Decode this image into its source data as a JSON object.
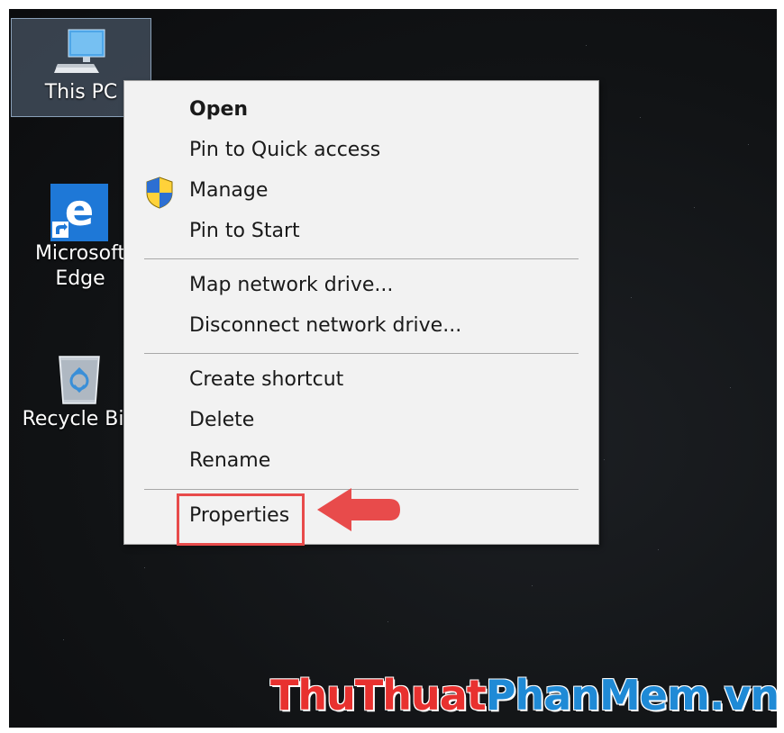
{
  "desktop": {
    "icons": [
      {
        "label": "This PC",
        "icon": "this-pc-icon"
      },
      {
        "label_line1": "Microsoft",
        "label_line2": "Edge",
        "icon": "edge-icon"
      },
      {
        "label": "Recycle Bin",
        "icon": "recycle-bin-icon"
      }
    ]
  },
  "context_menu": {
    "items": [
      {
        "label": "Open",
        "bold": true
      },
      {
        "label": "Pin to Quick access"
      },
      {
        "label": "Manage",
        "icon": "uac-shield-icon"
      },
      {
        "label": "Pin to Start"
      },
      {
        "label": "Map network drive..."
      },
      {
        "label": "Disconnect network drive..."
      },
      {
        "label": "Create shortcut"
      },
      {
        "label": "Delete"
      },
      {
        "label": "Rename"
      },
      {
        "label": "Properties",
        "highlighted": true
      }
    ]
  },
  "annotation": {
    "highlight_color": "#e84b4b",
    "arrow_color": "#e84b4b"
  },
  "watermark": {
    "part1": "ThuThuat",
    "part2": "PhanMem",
    "part3": ".vn",
    "color_red": "#e8312f",
    "color_blue": "#1f8ad6"
  }
}
